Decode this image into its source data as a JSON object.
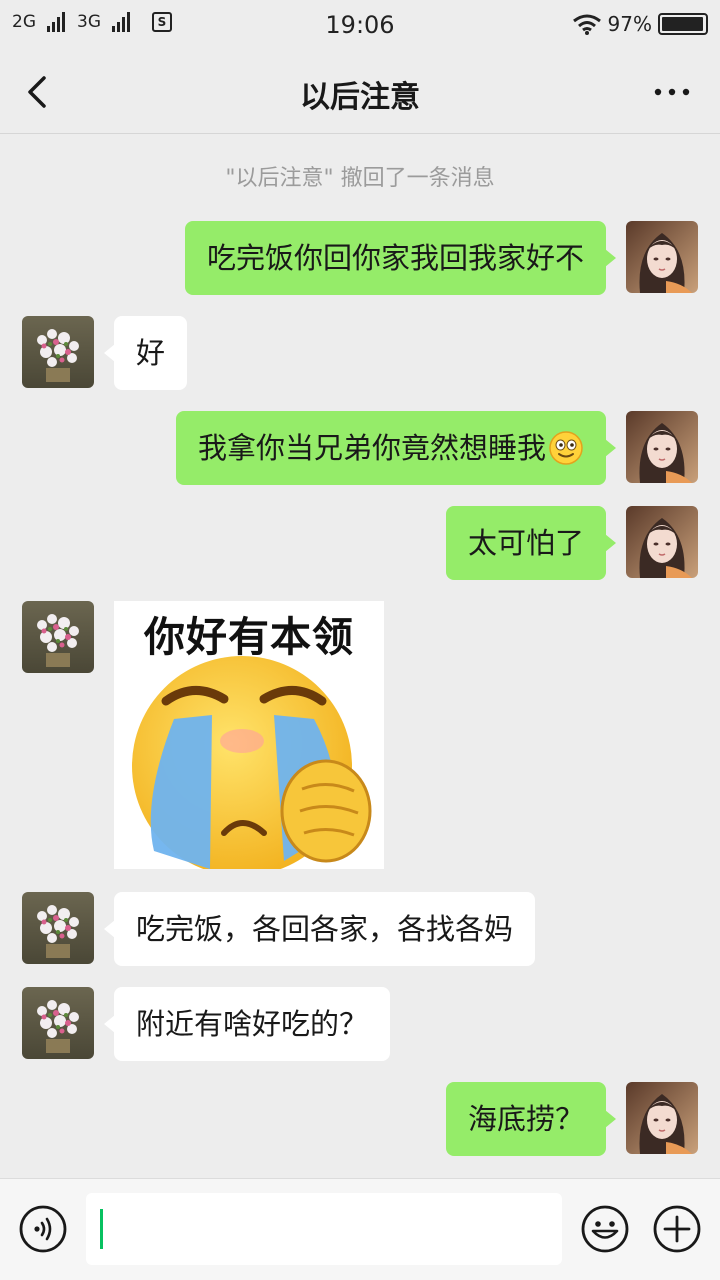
{
  "status_bar": {
    "net1": "2G",
    "net2": "3G",
    "time": "19:06",
    "battery_pct": "97%",
    "battery_level": 0.97
  },
  "nav": {
    "title": "以后注意"
  },
  "system_notice": "\"以后注意\" 撤回了一条消息",
  "messages": [
    {
      "from": "me",
      "text": "吃完饭你回你家我回我家好不"
    },
    {
      "from": "them",
      "text": "好"
    },
    {
      "from": "me",
      "text": "我拿你当兄弟你竟然想睡我"
    },
    {
      "from": "me",
      "text": "太可怕了"
    },
    {
      "from": "them",
      "type": "sticker",
      "text": "你好有本领"
    },
    {
      "from": "them",
      "text": "吃完饭，各回各家，各找各妈"
    },
    {
      "from": "them",
      "text": "附近有啥好吃的？"
    },
    {
      "from": "me",
      "text": "海底捞？"
    }
  ],
  "input": {
    "value": ""
  },
  "icons": {
    "back": "chevron-left-icon",
    "more": "more-dots-icon",
    "voice": "voice-icon",
    "emoji": "emoji-icon",
    "plus": "plus-icon"
  },
  "colors": {
    "my_bubble": "#95ec69",
    "their_bubble": "#ffffff",
    "background": "#ededed",
    "caret": "#07c160"
  }
}
